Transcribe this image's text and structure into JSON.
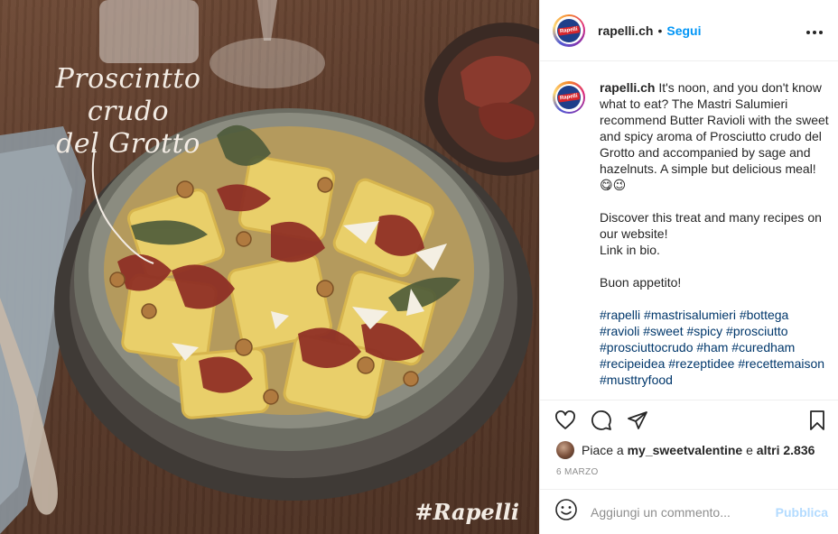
{
  "post": {
    "photo": {
      "caption_line1": "Proscintto crudo",
      "caption_line2": "del Grotto",
      "brand_tag": "#Rapelli"
    },
    "header": {
      "username": "rapelli.ch",
      "separator": "•",
      "follow_label": "Segui",
      "more_label": "•••",
      "avatar_text": "Rapelli"
    },
    "caption": {
      "username": "rapelli.ch",
      "paragraph1": "It's noon, and you don't know what to eat? The Mastri Salumieri recommend Butter Ravioli with the sweet and spicy aroma of Prosciutto crudo del Grotto and accompanied by sage and hazelnuts. A simple but delicious meal! 😋😉",
      "paragraph2_line1": "Discover this treat and many recipes on our website!",
      "paragraph2_line2": "Link in bio.",
      "paragraph3": "Buon appetito!",
      "hashtags": "#rapelli #mastrisalumieri #bottega #ravioli #sweet #spicy #prosciutto #prosciuttocrudo #ham #curedham #recipeidea #rezeptidee #recettemaison #musttryfood"
    },
    "actions": {
      "like_icon": "heart-icon",
      "comment_icon": "comment-icon",
      "share_icon": "share-icon",
      "save_icon": "bookmark-icon"
    },
    "likes": {
      "prefix": "Piace a",
      "user": "my_sweetvalentine",
      "middle": "e",
      "count_text": "altri 2.836"
    },
    "date": "6 MARZO",
    "add_comment": {
      "placeholder": "Aggiungi un commento...",
      "publish_label": "Pubblica"
    }
  },
  "colors": {
    "accent": "#0095f6",
    "publish_disabled": "#b3dbff",
    "hashtag": "#00376b",
    "muted": "#8e8e8e"
  }
}
